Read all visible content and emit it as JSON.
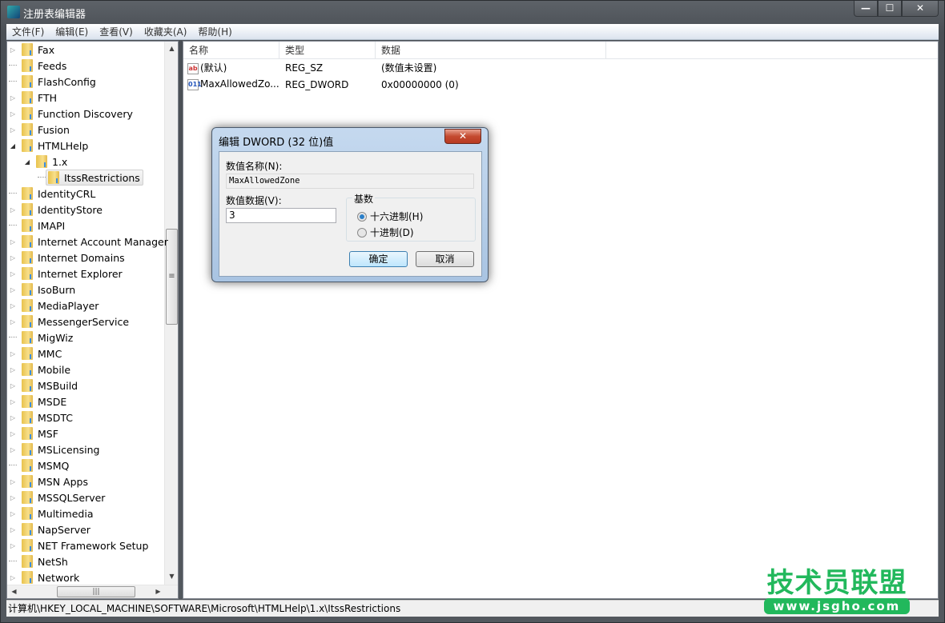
{
  "window": {
    "title": "注册表编辑器",
    "min": "—",
    "max": "☐",
    "close": "✕"
  },
  "menu": [
    "文件(F)",
    "编辑(E)",
    "查看(V)",
    "收藏夹(A)",
    "帮助(H)"
  ],
  "tree": [
    {
      "label": "Fax",
      "level": 0,
      "state": "collapsed"
    },
    {
      "label": "Feeds",
      "level": 0,
      "state": "leaf"
    },
    {
      "label": "FlashConfig",
      "level": 0,
      "state": "leaf"
    },
    {
      "label": "FTH",
      "level": 0,
      "state": "collapsed"
    },
    {
      "label": "Function Discovery",
      "level": 0,
      "state": "collapsed"
    },
    {
      "label": "Fusion",
      "level": 0,
      "state": "collapsed"
    },
    {
      "label": "HTMLHelp",
      "level": 0,
      "state": "expanded"
    },
    {
      "label": "1.x",
      "level": 1,
      "state": "expanded"
    },
    {
      "label": "ItssRestrictions",
      "level": 2,
      "state": "leaf",
      "selected": true
    },
    {
      "label": "IdentityCRL",
      "level": 0,
      "state": "leaf"
    },
    {
      "label": "IdentityStore",
      "level": 0,
      "state": "collapsed"
    },
    {
      "label": "IMAPI",
      "level": 0,
      "state": "leaf"
    },
    {
      "label": "Internet Account Manager",
      "level": 0,
      "state": "collapsed"
    },
    {
      "label": "Internet Domains",
      "level": 0,
      "state": "collapsed"
    },
    {
      "label": "Internet Explorer",
      "level": 0,
      "state": "collapsed"
    },
    {
      "label": "IsoBurn",
      "level": 0,
      "state": "collapsed"
    },
    {
      "label": "MediaPlayer",
      "level": 0,
      "state": "collapsed"
    },
    {
      "label": "MessengerService",
      "level": 0,
      "state": "collapsed"
    },
    {
      "label": "MigWiz",
      "level": 0,
      "state": "leaf"
    },
    {
      "label": "MMC",
      "level": 0,
      "state": "collapsed"
    },
    {
      "label": "Mobile",
      "level": 0,
      "state": "collapsed"
    },
    {
      "label": "MSBuild",
      "level": 0,
      "state": "collapsed"
    },
    {
      "label": "MSDE",
      "level": 0,
      "state": "collapsed"
    },
    {
      "label": "MSDTC",
      "level": 0,
      "state": "collapsed"
    },
    {
      "label": "MSF",
      "level": 0,
      "state": "collapsed"
    },
    {
      "label": "MSLicensing",
      "level": 0,
      "state": "collapsed"
    },
    {
      "label": "MSMQ",
      "level": 0,
      "state": "leaf"
    },
    {
      "label": "MSN Apps",
      "level": 0,
      "state": "collapsed"
    },
    {
      "label": "MSSQLServer",
      "level": 0,
      "state": "collapsed"
    },
    {
      "label": "Multimedia",
      "level": 0,
      "state": "collapsed"
    },
    {
      "label": "NapServer",
      "level": 0,
      "state": "collapsed"
    },
    {
      "label": "NET Framework Setup",
      "level": 0,
      "state": "collapsed"
    },
    {
      "label": "NetSh",
      "level": 0,
      "state": "leaf"
    },
    {
      "label": "Network",
      "level": 0,
      "state": "collapsed"
    }
  ],
  "list": {
    "columns": [
      "名称",
      "类型",
      "数据"
    ],
    "rows": [
      {
        "icon": "string-value-icon",
        "icon_text": "ab",
        "name": "(默认)",
        "type": "REG_SZ",
        "data": "(数值未设置)"
      },
      {
        "icon": "binary-value-icon",
        "icon_text": "011",
        "name": "MaxAllowedZo...",
        "type": "REG_DWORD",
        "data": "0x00000000 (0)"
      }
    ]
  },
  "status": "计算机\\HKEY_LOCAL_MACHINE\\SOFTWARE\\Microsoft\\HTMLHelp\\1.x\\ItssRestrictions",
  "dialog": {
    "title": "编辑 DWORD (32 位)值",
    "name_label": "数值名称(N):",
    "name_value": "MaxAllowedZone",
    "data_label": "数值数据(V):",
    "data_value": "3",
    "base_label": "基数",
    "hex_label": "十六进制(H)",
    "dec_label": "十进制(D)",
    "base_selected": "hex",
    "ok": "确定",
    "cancel": "取消",
    "close": "✕"
  },
  "watermark": {
    "text": "技术员联盟",
    "url": "www.jsgho.com"
  },
  "colors": {
    "watermark": "#22b85c",
    "selection": "#e6e6e6",
    "frame": "#53585e"
  }
}
